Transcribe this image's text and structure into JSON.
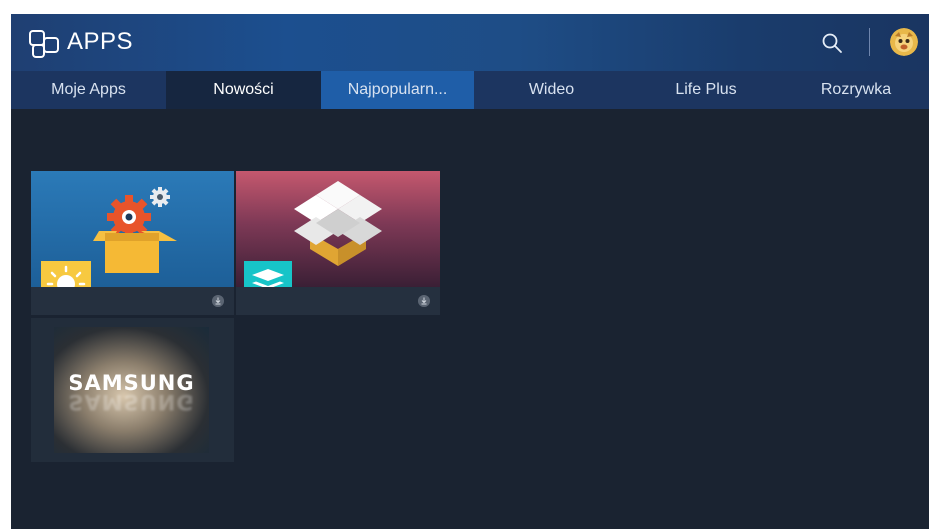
{
  "header": {
    "title": "APPS",
    "logo_icon": "apps-icon",
    "search_icon": "search-icon",
    "avatar_icon": "profile-avatar-icon"
  },
  "tabs": [
    {
      "label": "Moje Apps"
    },
    {
      "label": "Nowości"
    },
    {
      "label": "Najpopularn..."
    },
    {
      "label": "Wideo"
    },
    {
      "label": "Life Plus"
    },
    {
      "label": "Rozrywka"
    }
  ],
  "active_tab": "Nowości",
  "tiles": [
    {
      "name": "settings-app",
      "badge_icon": "lightbulb-icon",
      "download_icon": "download-icon"
    },
    {
      "name": "box-app",
      "badge_icon": "layers-icon",
      "download_icon": "download-icon"
    },
    {
      "name": "samsung-app",
      "text": "SAMSUNG"
    }
  ],
  "colors": {
    "background": "#1a2331",
    "header": "#1c4f8f",
    "tab_bar": "#1c3560",
    "tab_focus": "#1f5ea8"
  }
}
